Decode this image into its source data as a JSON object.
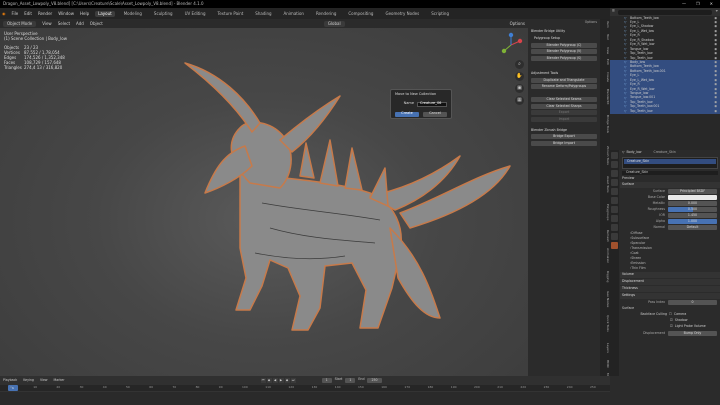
{
  "titlebar": {
    "title": "Dragon_Asset_Lowpoly_V8.blend] [C:\\Users\\Creature\\Scale\\Asset_Lowpoly_V8.blend] - Blender 4.1.0",
    "controls": [
      "—",
      "❐",
      "✕"
    ]
  },
  "menubar": {
    "menus": [
      "File",
      "Edit",
      "Render",
      "Window",
      "Help"
    ],
    "tabs": [
      "Layout",
      "Modeling",
      "Sculpting",
      "UV Editing",
      "Texture Paint",
      "Shading",
      "Animation",
      "Rendering",
      "Compositing",
      "Geometry Nodes",
      "Scripting"
    ],
    "active_tab": "Layout",
    "scene": "Scene",
    "view_layer": "ViewLayer"
  },
  "viewport_header": {
    "mode": "Object Mode",
    "menus": [
      "View",
      "Select",
      "Add",
      "Object"
    ],
    "orientation": "Global",
    "options": "Options"
  },
  "stats": {
    "view": "User Perspective",
    "collection": "(1) Scene Collection | Body_low",
    "rows": [
      [
        "Objects",
        "23 / 23"
      ],
      [
        "Vertices",
        "87,552 / 1,78,054"
      ],
      [
        "Edges",
        "174,526 / 1,352,348"
      ],
      [
        "Faces",
        "108,729 / 157,648"
      ],
      [
        "Triangles",
        "274,4 13 / 316,820"
      ]
    ]
  },
  "dialog": {
    "title": "Move to New Collection",
    "name_label": "Name",
    "name_value": "Creature_06",
    "ok_label": "Create",
    "cancel_label": "Cancel"
  },
  "tools_panel": {
    "sec1": "Blender Bridge Utility",
    "sec1b": "Polygroup Setup",
    "btns1": [
      "Blender Polygroup (C)",
      "Blender Polygroup (V)",
      "Blender Polygroup (S)"
    ],
    "sec2": "Adjustment Tools",
    "btns2": [
      "Duplicate and Triangulate",
      "Rename Deform/Polygroups"
    ],
    "btns3": [
      "Clear Selected Seams",
      "Clear Selected Sharps"
    ],
    "dim_btns": [
      "Export",
      "Import"
    ],
    "sec3": "Blender Zbrush Bridge",
    "btns4": [
      "Bridge Export",
      "Bridge Import"
    ]
  },
  "ntabs": [
    "Item",
    "Tool",
    "View",
    "Edit",
    "Create",
    "BlenderKit",
    "Bridge Tools",
    "Zbrush Tools",
    "Asset Tools",
    "Polygroups",
    "Remesh",
    "Animation",
    "Rigging",
    "Geo Nodes",
    "Quick Tools",
    "Layers",
    "HDRI",
    "Misc"
  ],
  "outliner": {
    "rows": [
      {
        "name": "Bottom_Teeth_low",
        "sel": false
      },
      {
        "name": "Eye_L",
        "sel": false
      },
      {
        "name": "Eye_L_Shadow",
        "sel": false
      },
      {
        "name": "Eye_L_Wet_low",
        "sel": false
      },
      {
        "name": "Eye_R",
        "sel": false
      },
      {
        "name": "Eye_R_Shadow",
        "sel": false
      },
      {
        "name": "Eye_R_Wet_low",
        "sel": false
      },
      {
        "name": "Tongue_low",
        "sel": false
      },
      {
        "name": "Top_Teeth_low",
        "sel": false
      },
      {
        "name": "Top_Teeth_low",
        "sel": false
      },
      {
        "name": "Body_low",
        "sel": true
      },
      {
        "name": "Bottom_Teeth_low",
        "sel": true
      },
      {
        "name": "Bottom_Teeth_low.001",
        "sel": true
      },
      {
        "name": "Eye_L",
        "sel": true
      },
      {
        "name": "Eye_L_Wet_low",
        "sel": true
      },
      {
        "name": "Eye_R",
        "sel": true
      },
      {
        "name": "Eye_R_Wet_low",
        "sel": true
      },
      {
        "name": "Tongue_low",
        "sel": true
      },
      {
        "name": "Tongue_low.001",
        "sel": true
      },
      {
        "name": "Top_Teeth_low",
        "sel": true
      },
      {
        "name": "Top_Teeth_low.001",
        "sel": true
      },
      {
        "name": "Top_Teeth_low",
        "sel": true
      }
    ]
  },
  "props": {
    "object": "Body_low",
    "material_slot": "Creature_Skin",
    "material": "Creature_Skin",
    "preview": "Preview",
    "surface": "Surface",
    "surface_type": "Principled BSDF",
    "fields": [
      {
        "label": "Base Color",
        "value": "",
        "kind": "color"
      },
      {
        "label": "Metallic",
        "value": "0.000",
        "kind": "num"
      },
      {
        "label": "Roughness",
        "value": "0.500",
        "kind": "blue",
        "pct": 50
      },
      {
        "label": "IOR",
        "value": "1.450",
        "kind": "num"
      },
      {
        "label": "Alpha",
        "value": "1.000",
        "kind": "blue",
        "pct": 100
      },
      {
        "label": "Normal",
        "value": "Default",
        "kind": "num"
      }
    ],
    "subs": [
      "Diffuse",
      "Subsurface",
      "Specular",
      "Transmission",
      "Coat",
      "Sheen",
      "Emission",
      "Thin Film"
    ],
    "sections": [
      "Volume",
      "Displacement",
      "Thickness",
      "Settings"
    ],
    "pass_index_label": "Pass Index",
    "pass_index": "0",
    "surface2": "Surface",
    "backface_label": "Backface Culling",
    "checks": [
      "Camera",
      "Shadow",
      "Light Probe Volume"
    ],
    "displacement_label": "Displacement",
    "displacement_value": "Bump Only"
  },
  "timeline": {
    "menus": [
      "Playback",
      "Keying",
      "View",
      "Marker"
    ],
    "frame_current": "1",
    "start_label": "Start",
    "start": "1",
    "end_label": "End",
    "end": "250",
    "ticks": [
      "0",
      "10",
      "20",
      "30",
      "40",
      "50",
      "60",
      "70",
      "80",
      "90",
      "100",
      "110",
      "120",
      "130",
      "140",
      "150",
      "160",
      "170",
      "180",
      "190",
      "200",
      "210",
      "220",
      "230",
      "240",
      "250"
    ]
  }
}
